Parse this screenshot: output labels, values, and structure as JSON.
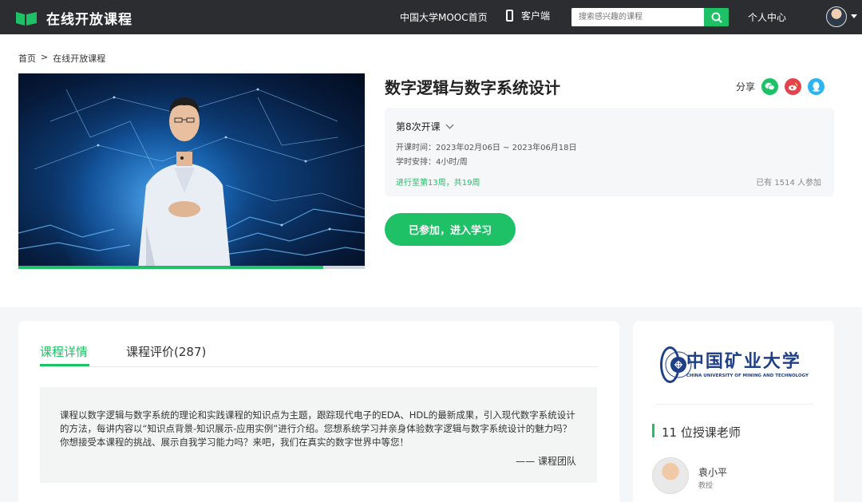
{
  "header": {
    "logo_text": "在线开放课程",
    "nav_home": "中国大学MOOC首页",
    "nav_client": "客户端",
    "search_placeholder": "搜索感兴趣的课程",
    "nav_personal": "个人中心"
  },
  "breadcrumb": [
    "首页",
    ">",
    "在线开放课程"
  ],
  "video": {
    "progress_fraction": 0.88
  },
  "course": {
    "title": "数字逻辑与数字系统设计",
    "share_label": "分享",
    "term": "第8次开课",
    "time_label": "开课时间：",
    "time_value": "2023年02月06日 ~ 2023年06月18日",
    "schedule_label": "学时安排：",
    "schedule_value": "4小时/周",
    "progress": "进行至第13周，共19周",
    "enrolled": "已有 1514 人参加",
    "join_button": "已参加，进入学习"
  },
  "tabs": {
    "details": "课程详情",
    "reviews": "课程评价(287)"
  },
  "description": {
    "text": "课程以数字逻辑与数字系统的理论和实践课程的知识点为主题，跟踪现代电子的EDA、HDL的最新成果，引入现代数字系统设计的方法，每讲内容以“知识点背景-知识展示-应用实例”进行介绍。您想系统学习并亲身体验数字逻辑与数字系统设计的魅力吗？你想接受本课程的挑战、展示自我学习能力吗？来吧，我们在真实的数字世界中等您！",
    "signature": "—— 课程团队"
  },
  "sidebar": {
    "university_cn": "中国矿业大学",
    "university_en": "CHINA UNIVERSITY OF MINING AND TECHNOLOGY",
    "teacher_count": "11 位授课老师",
    "teacher_name": "袁小平",
    "teacher_title": "教授"
  },
  "colors": {
    "accent": "#1ec166",
    "header_bg": "#2b2d30",
    "wechat": "#1ec166",
    "weibo": "#e6424b",
    "qq": "#2fb3f0",
    "university": "#1f3f86"
  },
  "icons": [
    "logo-book-icon",
    "phone-icon",
    "search-icon",
    "user-avatar",
    "chevron-down-icon",
    "wechat-icon",
    "weibo-icon",
    "qq-icon"
  ]
}
